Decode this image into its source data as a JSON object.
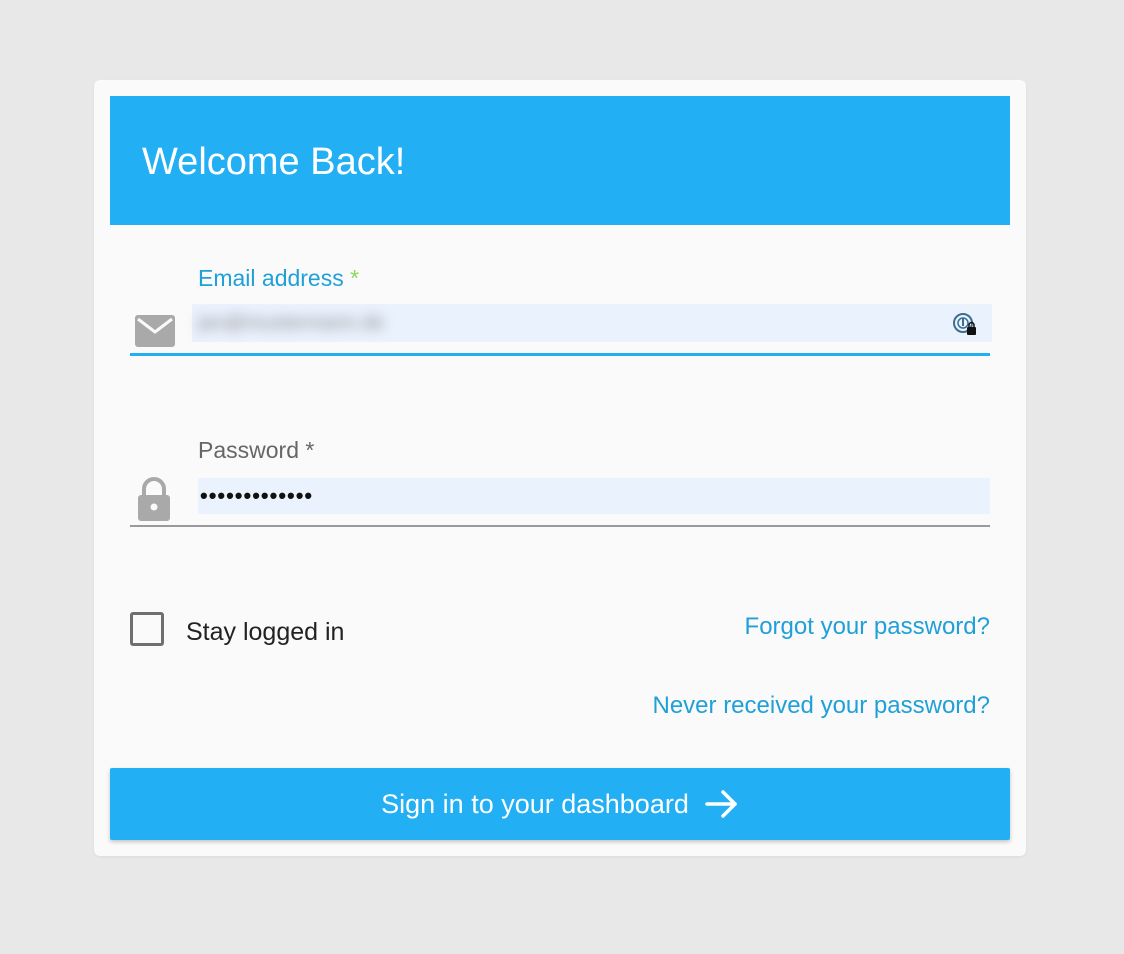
{
  "header": {
    "title": "Welcome Back!"
  },
  "email": {
    "label": "Email address",
    "required_marker": "*",
    "value": "jan@mustermann.de",
    "icon": "mail-icon",
    "field_icon": "password-manager-icon"
  },
  "password": {
    "label": "Password *",
    "masked_value": "•••••••••••••",
    "icon": "lock-icon"
  },
  "remember": {
    "label": "Stay logged in",
    "checked": false
  },
  "links": {
    "forgot": "Forgot your password?",
    "never_received": "Never received your password?"
  },
  "submit": {
    "label": "Sign in to your dashboard",
    "icon": "arrow-right-icon"
  },
  "colors": {
    "accent": "#22aff4",
    "link": "#1fa0d8",
    "required_green": "#8fd462",
    "input_fill": "#eaf2fe",
    "background": "#e8e8e8"
  }
}
